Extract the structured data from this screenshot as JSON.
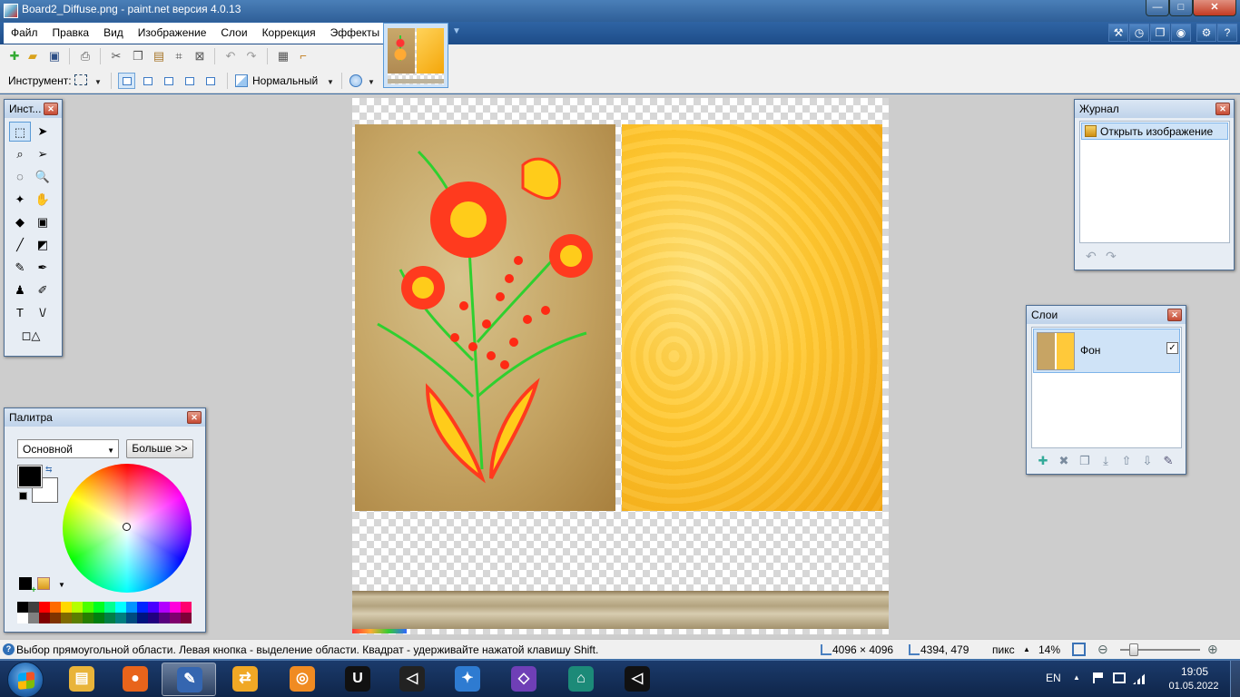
{
  "window": {
    "title": "Board2_Diffuse.png - paint.net версия 4.0.13",
    "min_label": "—",
    "max_label": "□",
    "close_label": "✕"
  },
  "menu": {
    "items": [
      "Файл",
      "Правка",
      "Вид",
      "Изображение",
      "Слои",
      "Коррекция",
      "Эффекты"
    ]
  },
  "toolbar": {
    "tool_label": "Инструмент:",
    "blend_mode": "Нормальный"
  },
  "tools_window": {
    "title": "Инст...",
    "tools": [
      {
        "name": "rectangle-select",
        "glyph": "⬚"
      },
      {
        "name": "move-selected",
        "glyph": "➤"
      },
      {
        "name": "lasso-select",
        "glyph": "⌕"
      },
      {
        "name": "move-selection",
        "glyph": "➢"
      },
      {
        "name": "ellipse-select",
        "glyph": "◌"
      },
      {
        "name": "zoom",
        "glyph": "🔍"
      },
      {
        "name": "magic-wand",
        "glyph": "✦"
      },
      {
        "name": "pan",
        "glyph": "✋"
      },
      {
        "name": "paint-bucket",
        "glyph": "◆"
      },
      {
        "name": "gradient",
        "glyph": "▣"
      },
      {
        "name": "paintbrush",
        "glyph": "╱"
      },
      {
        "name": "eraser",
        "glyph": "◩"
      },
      {
        "name": "pencil",
        "glyph": "✎"
      },
      {
        "name": "color-picker",
        "glyph": "✒"
      },
      {
        "name": "clone-stamp",
        "glyph": "♟"
      },
      {
        "name": "recolor",
        "glyph": "✐"
      },
      {
        "name": "text",
        "glyph": "T"
      },
      {
        "name": "line-curve",
        "glyph": "\\/"
      },
      {
        "name": "shapes",
        "glyph": "◻△"
      }
    ]
  },
  "palette_window": {
    "title": "Палитра",
    "mode": "Основной",
    "more_button": "Больше >>",
    "primary_color": "#000000",
    "secondary_color": "#ffffff",
    "swatches_top": [
      "#000000",
      "#404040",
      "#ff0000",
      "#ff6a00",
      "#ffd800",
      "#b6ff00",
      "#4cff00",
      "#00ff21",
      "#00ff90",
      "#00ffff",
      "#0094ff",
      "#0026ff",
      "#4800ff",
      "#b200ff",
      "#ff00dc",
      "#ff006e"
    ],
    "swatches_bottom": [
      "#ffffff",
      "#808080",
      "#7f0000",
      "#7f3300",
      "#7f6a00",
      "#5b7f00",
      "#267f00",
      "#007f0e",
      "#007f46",
      "#007f7f",
      "#004a7f",
      "#00137f",
      "#21007f",
      "#57007f",
      "#7f006e",
      "#7f0037"
    ]
  },
  "history_window": {
    "title": "Журнал",
    "items": [
      "Открыть изображение"
    ]
  },
  "layers_window": {
    "title": "Слои",
    "layers": [
      {
        "name": "Фон",
        "visible": true
      }
    ]
  },
  "status": {
    "help_text": "Выбор прямоугольной области. Левая кнопка - выделение области. Квадрат - удерживайте нажатой клавишу Shift.",
    "image_size": "4096 × 4096",
    "cursor_pos": "4394, 479",
    "units": "пикс",
    "zoom": "14%",
    "zoom_level": 0.14
  },
  "taskbar": {
    "apps": [
      {
        "name": "explorer",
        "color": "#e9b43a",
        "glyph": "▤"
      },
      {
        "name": "firefox",
        "color": "#e8641b",
        "glyph": "●"
      },
      {
        "name": "paint-net",
        "color": "#3566b0",
        "glyph": "✎"
      },
      {
        "name": "gitkraken",
        "color": "#f0a825",
        "glyph": "⇄"
      },
      {
        "name": "blender",
        "color": "#f08b22",
        "glyph": "◎"
      },
      {
        "name": "unreal-engine",
        "color": "#111111",
        "glyph": "U"
      },
      {
        "name": "unity",
        "color": "#222222",
        "glyph": "◁"
      },
      {
        "name": "app-icon",
        "color": "#2e7bd1",
        "glyph": "✦"
      },
      {
        "name": "visual-studio",
        "color": "#6f3fb6",
        "glyph": "◇"
      },
      {
        "name": "home-app",
        "color": "#1c8a78",
        "glyph": "⌂"
      },
      {
        "name": "unity-hub",
        "color": "#111111",
        "glyph": "◁"
      }
    ],
    "language": "EN",
    "time": "19:05",
    "date": "01.05.2022"
  }
}
